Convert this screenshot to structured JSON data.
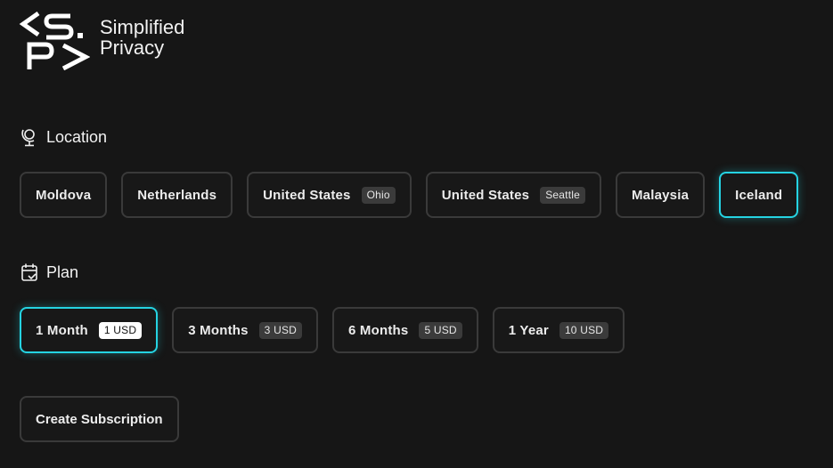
{
  "brand": {
    "line1": "Simplified",
    "line2": "Privacy",
    "logo_icon": "sp-logo-icon"
  },
  "location": {
    "title": "Location",
    "icon": "globe-stand-icon",
    "options": [
      {
        "label": "Moldova",
        "tag": ""
      },
      {
        "label": "Netherlands",
        "tag": ""
      },
      {
        "label": "United States",
        "tag": "Ohio"
      },
      {
        "label": "United States",
        "tag": "Seattle"
      },
      {
        "label": "Malaysia",
        "tag": ""
      },
      {
        "label": "Iceland",
        "tag": ""
      }
    ],
    "selected": "Iceland"
  },
  "plan": {
    "title": "Plan",
    "icon": "calendar-check-icon",
    "options": [
      {
        "label": "1 Month",
        "price": "1 USD"
      },
      {
        "label": "3 Months",
        "price": "3 USD"
      },
      {
        "label": "6 Months",
        "price": "5 USD"
      },
      {
        "label": "1 Year",
        "price": "10 USD"
      }
    ],
    "selected": "1 Month"
  },
  "actions": {
    "create_label": "Create Subscription"
  },
  "colors": {
    "background": "#161616",
    "accent": "#25d3e2",
    "border": "#3a3a3a"
  }
}
